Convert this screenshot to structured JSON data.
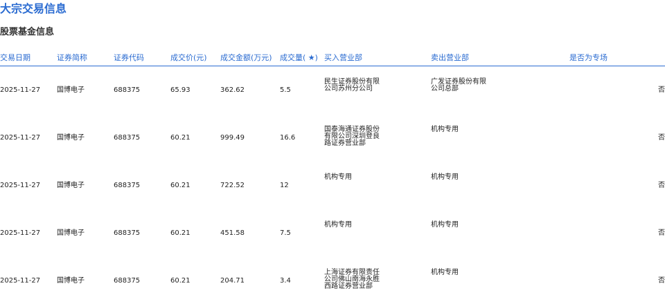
{
  "page": {
    "title": "大宗交易信息",
    "section_title": "股票基金信息"
  },
  "table": {
    "headers": {
      "date": "交易日期",
      "name": "证券简称",
      "code": "证券代码",
      "price": "成交价(元)",
      "amount": "成交金额(万元)",
      "volume": "成交量( ★)",
      "buyer": "买入营业部",
      "seller": "卖出营业部",
      "special": "是否为专场"
    },
    "rows": [
      {
        "date": "2025-11-27",
        "name": "国博电子",
        "code": "688375",
        "price": "65.93",
        "amount": "362.62",
        "volume": "5.5",
        "buyer": "民生证券股份有限公司苏州分公司",
        "seller": "广发证券股份有限公司总部",
        "special": "否"
      },
      {
        "date": "2025-11-27",
        "name": "国博电子",
        "code": "688375",
        "price": "60.21",
        "amount": "999.49",
        "volume": "16.6",
        "buyer": "国泰海通证券股份有限公司深圳登良路证券营业部",
        "seller": "机构专用",
        "special": "否"
      },
      {
        "date": "2025-11-27",
        "name": "国博电子",
        "code": "688375",
        "price": "60.21",
        "amount": "722.52",
        "volume": "12",
        "buyer": "机构专用",
        "seller": "机构专用",
        "special": "否"
      },
      {
        "date": "2025-11-27",
        "name": "国博电子",
        "code": "688375",
        "price": "60.21",
        "amount": "451.58",
        "volume": "7.5",
        "buyer": "机构专用",
        "seller": "机构专用",
        "special": "否"
      },
      {
        "date": "2025-11-27",
        "name": "国博电子",
        "code": "688375",
        "price": "60.21",
        "amount": "204.71",
        "volume": "3.4",
        "buyer": "上海证券有限责任公司佛山南海永胜西路证券营业部",
        "seller": "机构专用",
        "special": "否"
      }
    ]
  },
  "colors": {
    "accent": "#2a6bd1",
    "text": "#222222",
    "background": "#ffffff"
  }
}
